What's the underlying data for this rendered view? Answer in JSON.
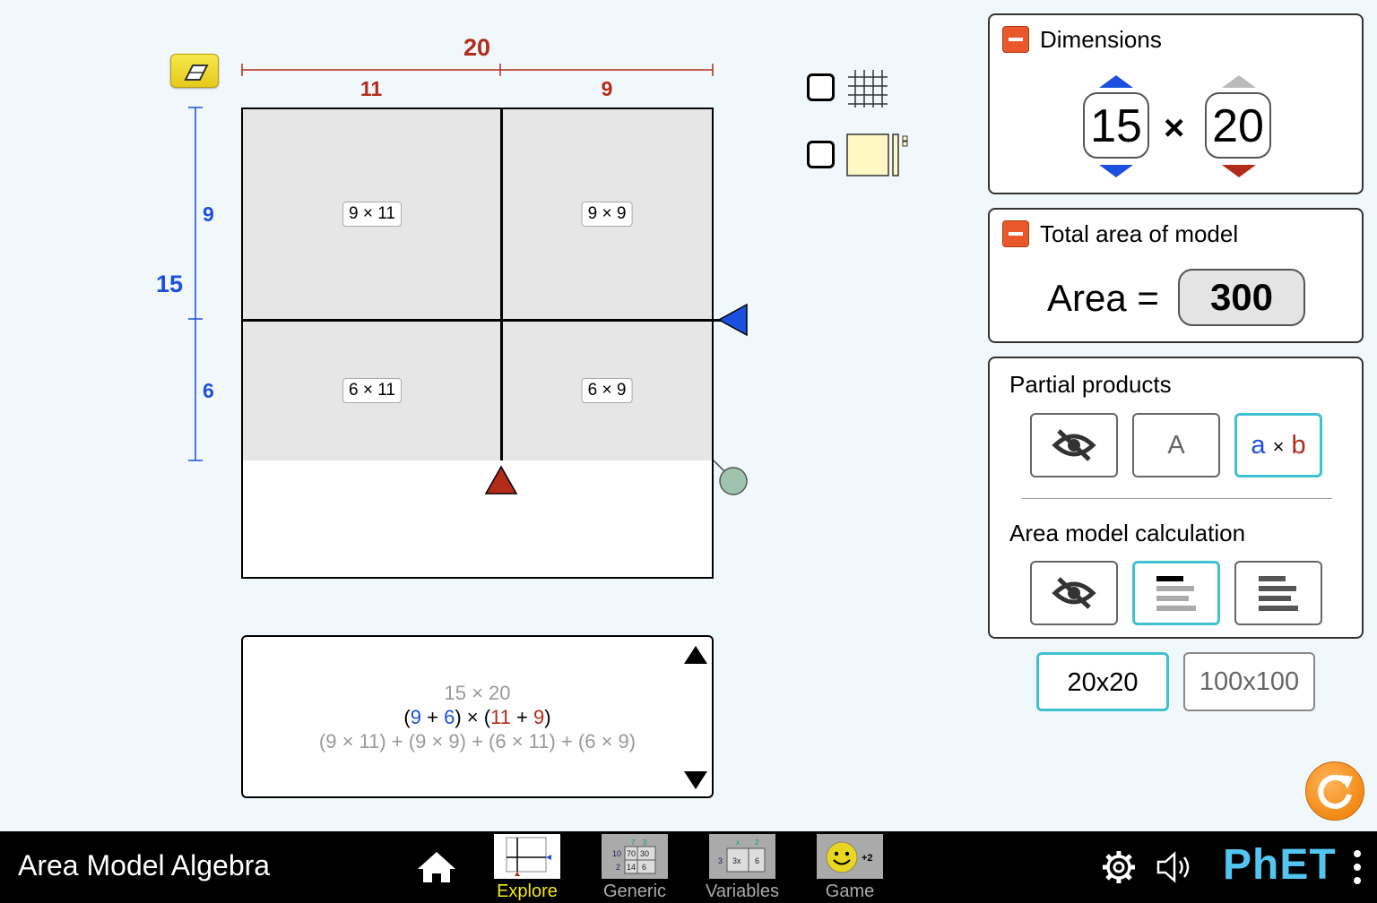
{
  "model": {
    "total_width": "20",
    "width_parts": [
      "11",
      "9"
    ],
    "total_height": "15",
    "height_parts": [
      "9",
      "6"
    ],
    "partial_products": [
      "9 × 11",
      "9 × 9",
      "6 × 11",
      "6 × 9"
    ]
  },
  "calculation": {
    "line1": "15 × 20",
    "line2": {
      "open1": "(",
      "a1": "9",
      "plus1": " + ",
      "a2": "6",
      "mid": ") × (",
      "b1": "11",
      "plus2": " + ",
      "b2": "9",
      "close": ")"
    },
    "line3": "(9 × 11) + (9 × 9) + (6 × 11) + (6 × 9)"
  },
  "dimensions_panel": {
    "title": "Dimensions",
    "height_value": "15",
    "times": "×",
    "width_value": "20"
  },
  "area_panel": {
    "title": "Total area of model",
    "label": "Area =",
    "value": "300"
  },
  "options_panel": {
    "partial_products_title": "Partial products",
    "partial_options": [
      "hide",
      "A",
      "a × b"
    ],
    "partial_selected": "a × b",
    "calc_title": "Area model calculation",
    "calc_options": [
      "hide",
      "line-by-line",
      "all-lines"
    ],
    "calc_selected": "line-by-line"
  },
  "grid_size": {
    "options": [
      "20x20",
      "100x100"
    ],
    "selected": "20x20"
  },
  "colors": {
    "width_color": "#b42b1a",
    "height_color": "#1b4fe0",
    "accent_selected": "#3ec2d2",
    "reset_orange": "#f38a16",
    "minus_orange": "#e8582a"
  },
  "navbar": {
    "sim_title": "Area Model Algebra",
    "screens": [
      {
        "label": "Explore",
        "active": true
      },
      {
        "label": "Generic",
        "active": false
      },
      {
        "label": "Variables",
        "active": false
      },
      {
        "label": "Game",
        "active": false
      }
    ],
    "generic_icon_text": {
      "top": [
        "7",
        "3"
      ],
      "rows": [
        [
          "10",
          "70",
          "30"
        ],
        [
          "2",
          "14",
          "6"
        ]
      ]
    },
    "variables_icon_text": {
      "top": [
        "x",
        "2"
      ],
      "rows": [
        [
          "3",
          "3x",
          "6"
        ]
      ]
    },
    "game_icon_text": "+2",
    "brand": "PhET"
  }
}
